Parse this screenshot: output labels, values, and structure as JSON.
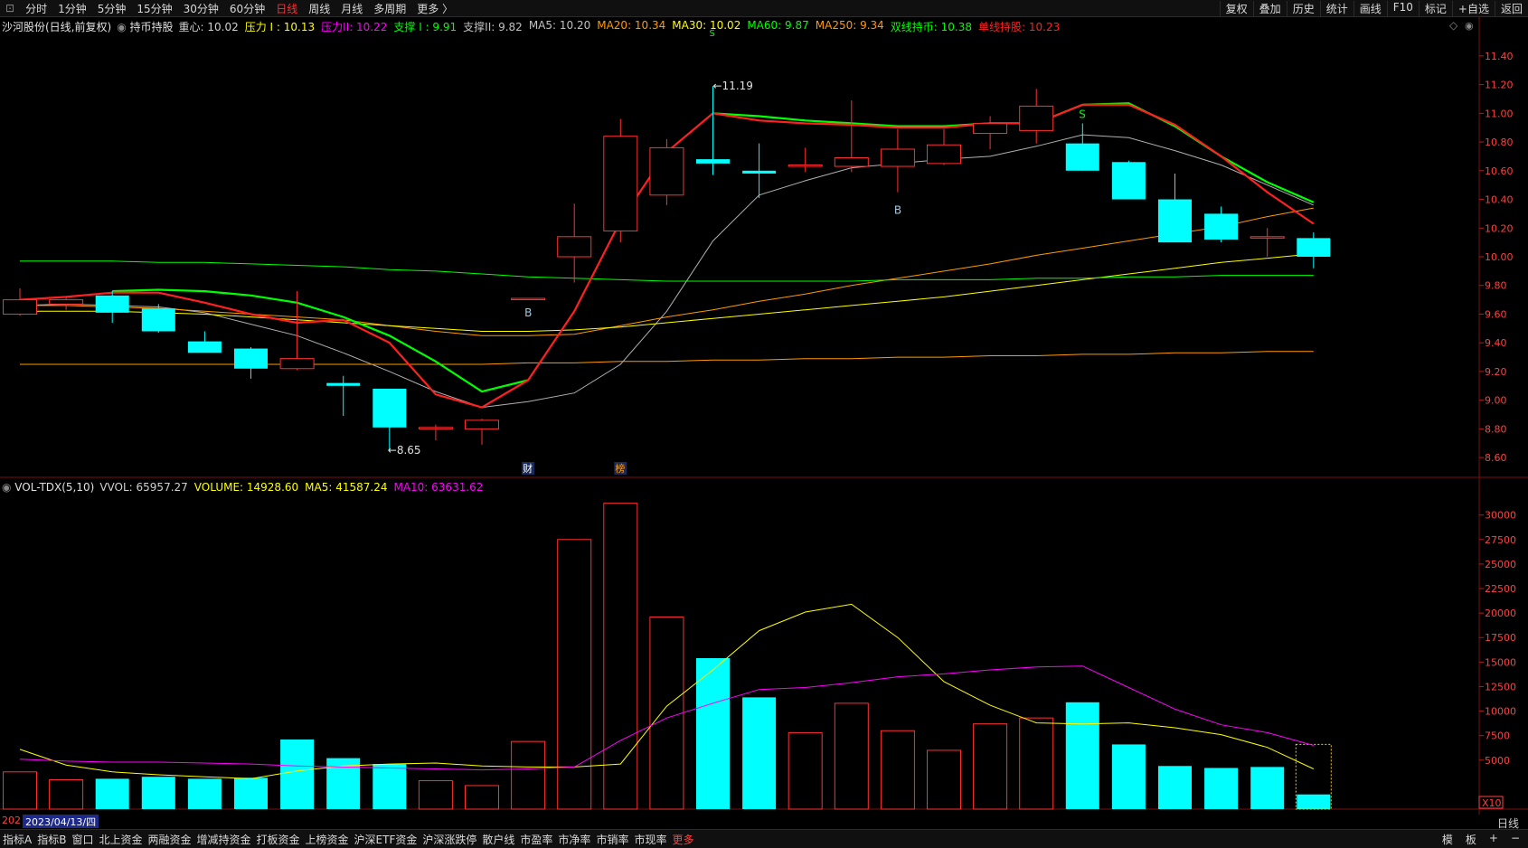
{
  "topbar": {
    "tabs": [
      "分时",
      "1分钟",
      "5分钟",
      "15分钟",
      "30分钟",
      "60分钟",
      "日线",
      "周线",
      "月线",
      "多周期",
      "更多 〉"
    ],
    "active_tab": "日线",
    "right_tabs": [
      "复权",
      "叠加",
      "历史",
      "统计",
      "画线",
      "F10",
      "标记",
      "+自选",
      "返回"
    ]
  },
  "main_legend": {
    "stock": "沙河股份(日线,前复权)",
    "indicator": "持币持股",
    "items": [
      {
        "text": "重心: 10.02",
        "color": "#d0d0d0"
      },
      {
        "text": "压力 I : 10.13",
        "color": "#ffff00"
      },
      {
        "text": "压力II: 10.22",
        "color": "#ff00ff"
      },
      {
        "text": "支撑 I : 9.91",
        "color": "#00ff00"
      },
      {
        "text": "支撑II: 9.82",
        "color": "#c0c0c0"
      },
      {
        "text": "MA5: 10.20",
        "color": "#c0c0c0"
      },
      {
        "text": "MA20: 10.34",
        "color": "#ff9900"
      },
      {
        "text": "MA30: 10.02",
        "color": "#ffff00"
      },
      {
        "text": "MA60: 9.87",
        "color": "#00ff00"
      },
      {
        "text": "MA250: 9.34",
        "color": "#ff9900"
      },
      {
        "text": "双线持币: 10.38",
        "color": "#00ff00"
      },
      {
        "text": "单线持股: 10.23",
        "color": "#ff2020"
      }
    ]
  },
  "vol_legend": {
    "name": "VOL-TDX(5,10)",
    "items": [
      {
        "text": "VVOL: 65957.27",
        "color": "#d0d0d0"
      },
      {
        "text": "VOLUME: 14928.60",
        "color": "#ffff00"
      },
      {
        "text": "MA5: 41587.24",
        "color": "#ffff00"
      },
      {
        "text": "MA10: 63631.62",
        "color": "#ff00ff"
      }
    ]
  },
  "markers": {
    "high_label": "11.19",
    "low_label": "8.65",
    "b1": "B",
    "b2": "B",
    "s1": "S",
    "s_top": "S",
    "cai": "财",
    "bang": "榜",
    "vol_scale": "X10",
    "vol_mark": "5"
  },
  "date_bar": {
    "year_prefix": "202",
    "date": "2023/04/13/四"
  },
  "period_label": "日线",
  "bottombar": {
    "tabs": [
      "指标A",
      "指标B",
      "窗口",
      "北上资金",
      "两融资金",
      "增减持资金",
      "打板资金",
      "上榜资金",
      "沪深ETF资金",
      "沪深涨跌停",
      "散户线",
      "市盈率",
      "市净率",
      "市销率",
      "市现率",
      "更多"
    ],
    "highlight": "更多",
    "right_tabs": [
      "模",
      "板",
      "+",
      "−"
    ]
  },
  "chart_data": [
    {
      "type": "candlestick",
      "ylim": [
        8.5,
        11.5
      ],
      "yticks": [
        8.6,
        8.8,
        9.0,
        9.2,
        9.4,
        9.6,
        9.8,
        10.0,
        10.2,
        10.4,
        10.6,
        10.8,
        11.0,
        11.2,
        11.4
      ],
      "candles": [
        {
          "o": 9.6,
          "h": 9.78,
          "l": 9.59,
          "c": 9.7
        },
        {
          "o": 9.67,
          "h": 9.72,
          "l": 9.63,
          "c": 9.7
        },
        {
          "o": 9.73,
          "h": 9.76,
          "l": 9.54,
          "c": 9.61
        },
        {
          "o": 9.64,
          "h": 9.67,
          "l": 9.47,
          "c": 9.48
        },
        {
          "o": 9.41,
          "h": 9.48,
          "l": 9.34,
          "c": 9.33
        },
        {
          "o": 9.36,
          "h": 9.37,
          "l": 9.15,
          "c": 9.22
        },
        {
          "o": 9.22,
          "h": 9.76,
          "l": 9.21,
          "c": 9.29
        },
        {
          "o": 9.12,
          "h": 9.17,
          "l": 8.89,
          "c": 9.1
        },
        {
          "o": 9.08,
          "h": 9.08,
          "l": 8.65,
          "c": 8.81
        },
        {
          "o": 8.8,
          "h": 8.83,
          "l": 8.72,
          "c": 8.81
        },
        {
          "o": 8.8,
          "h": 8.87,
          "l": 8.69,
          "c": 8.86
        },
        {
          "o": 9.71,
          "h": 9.71,
          "l": 9.71,
          "c": 9.71
        },
        {
          "o": 10.0,
          "h": 10.37,
          "l": 9.82,
          "c": 10.14
        },
        {
          "o": 10.18,
          "h": 10.96,
          "l": 10.1,
          "c": 10.84
        },
        {
          "o": 10.43,
          "h": 10.82,
          "l": 10.36,
          "c": 10.76
        },
        {
          "o": 10.68,
          "h": 11.19,
          "l": 10.57,
          "c": 10.65
        },
        {
          "o": 10.6,
          "h": 10.79,
          "l": 10.41,
          "c": 10.58
        },
        {
          "o": 10.63,
          "h": 10.76,
          "l": 10.59,
          "c": 10.64
        },
        {
          "o": 10.63,
          "h": 11.09,
          "l": 10.59,
          "c": 10.69
        },
        {
          "o": 10.63,
          "h": 10.89,
          "l": 10.45,
          "c": 10.75
        },
        {
          "o": 10.65,
          "h": 10.89,
          "l": 10.64,
          "c": 10.78
        },
        {
          "o": 10.86,
          "h": 10.98,
          "l": 10.75,
          "c": 10.93
        },
        {
          "o": 10.88,
          "h": 11.17,
          "l": 10.79,
          "c": 11.05
        },
        {
          "o": 10.79,
          "h": 10.93,
          "l": 10.6,
          "c": 10.6
        },
        {
          "o": 10.66,
          "h": 10.67,
          "l": 10.41,
          "c": 10.4
        },
        {
          "o": 10.4,
          "h": 10.58,
          "l": 10.29,
          "c": 10.1
        },
        {
          "o": 10.3,
          "h": 10.35,
          "l": 10.1,
          "c": 10.12
        },
        {
          "o": 10.13,
          "h": 10.2,
          "l": 10.0,
          "c": 10.14
        },
        {
          "o": 10.13,
          "h": 10.17,
          "l": 9.92,
          "c": 10.0
        }
      ],
      "series": [
        {
          "name": "MA5",
          "color": "#b0b0b0",
          "values": [
            9.66,
            9.67,
            9.66,
            9.65,
            9.61,
            9.53,
            9.45,
            9.33,
            9.2,
            9.06,
            8.95,
            8.99,
            9.05,
            9.25,
            9.62,
            10.11,
            10.43,
            10.53,
            10.62,
            10.65,
            10.68,
            10.7,
            10.77,
            10.85,
            10.83,
            10.74,
            10.64,
            10.5,
            10.36
          ]
        },
        {
          "name": "MA20",
          "color": "#ff9900",
          "values": [
            9.66,
            9.66,
            9.65,
            9.64,
            9.62,
            9.6,
            9.58,
            9.56,
            9.52,
            9.48,
            9.45,
            9.45,
            9.46,
            9.52,
            9.58,
            9.63,
            9.69,
            9.74,
            9.8,
            9.85,
            9.9,
            9.95,
            10.01,
            10.06,
            10.11,
            10.16,
            10.21,
            10.28,
            10.34
          ]
        },
        {
          "name": "MA30",
          "color": "#ffff00",
          "values": [
            9.62,
            9.62,
            9.62,
            9.61,
            9.6,
            9.58,
            9.56,
            9.54,
            9.52,
            9.5,
            9.48,
            9.48,
            9.49,
            9.51,
            9.54,
            9.57,
            9.6,
            9.63,
            9.66,
            9.69,
            9.72,
            9.76,
            9.8,
            9.84,
            9.88,
            9.92,
            9.96,
            9.99,
            10.02
          ]
        },
        {
          "name": "MA60",
          "color": "#00ff00",
          "values": [
            9.97,
            9.97,
            9.97,
            9.96,
            9.96,
            9.95,
            9.94,
            9.93,
            9.91,
            9.9,
            9.88,
            9.86,
            9.85,
            9.84,
            9.83,
            9.83,
            9.83,
            9.83,
            9.83,
            9.84,
            9.84,
            9.84,
            9.85,
            9.85,
            9.86,
            9.86,
            9.87,
            9.87,
            9.87
          ]
        },
        {
          "name": "MA250",
          "color": "#ff9900",
          "values": [
            9.25,
            9.25,
            9.25,
            9.25,
            9.25,
            9.25,
            9.25,
            9.25,
            9.25,
            9.25,
            9.25,
            9.26,
            9.26,
            9.27,
            9.27,
            9.28,
            9.28,
            9.29,
            9.29,
            9.3,
            9.3,
            9.31,
            9.31,
            9.32,
            9.32,
            9.33,
            9.33,
            9.34,
            9.34
          ]
        },
        {
          "name": "双线持币",
          "color": "#00ff00",
          "values": [
            null,
            null,
            9.76,
            9.77,
            9.76,
            9.73,
            9.68,
            9.58,
            9.45,
            9.27,
            9.06,
            9.14,
            null,
            null,
            null,
            11.0,
            10.98,
            10.95,
            10.93,
            10.91,
            10.91,
            10.93,
            10.93,
            11.06,
            11.07,
            10.91,
            10.7,
            10.52,
            10.38
          ]
        },
        {
          "name": "单线持股",
          "color": "#ff2020",
          "values": [
            9.7,
            9.72,
            9.75,
            9.75,
            9.68,
            9.6,
            9.54,
            9.56,
            9.4,
            9.04,
            8.95,
            9.14,
            9.62,
            10.25,
            10.73,
            11.0,
            10.95,
            10.93,
            10.92,
            10.9,
            10.9,
            10.93,
            10.93,
            11.06,
            11.06,
            10.92,
            10.7,
            10.45,
            10.23
          ]
        }
      ]
    },
    {
      "type": "bar",
      "title": "VOL-TDX(5,10)",
      "ylim": [
        0,
        32000
      ],
      "yticks": [
        5000,
        7500,
        10000,
        12500,
        15000,
        17500,
        20000,
        22500,
        25000,
        27500,
        30000
      ],
      "values": [
        3800,
        3000,
        3100,
        3300,
        3100,
        3200,
        7100,
        5200,
        4600,
        2900,
        2400,
        6900,
        27500,
        31200,
        19600,
        15400,
        11400,
        7800,
        10800,
        8000,
        6000,
        8700,
        9300,
        10900,
        6600,
        4400,
        4200,
        4300,
        1500
      ],
      "up": [
        true,
        true,
        false,
        false,
        false,
        false,
        false,
        false,
        false,
        true,
        true,
        true,
        true,
        true,
        true,
        false,
        false,
        true,
        true,
        true,
        true,
        true,
        true,
        false,
        false,
        false,
        false,
        false,
        false
      ],
      "series": [
        {
          "name": "MA5",
          "color": "#ffff00",
          "values": [
            6100,
            4500,
            3800,
            3500,
            3300,
            3100,
            3900,
            4400,
            4600,
            4700,
            4400,
            4300,
            4300,
            4600,
            10500,
            14200,
            18200,
            20100,
            20900,
            17500,
            13000,
            10600,
            8800,
            8700,
            8800,
            8300,
            7600,
            6300,
            4100
          ]
        },
        {
          "name": "MA10",
          "color": "#ff00ff",
          "values": [
            5100,
            4900,
            4800,
            4800,
            4700,
            4600,
            4400,
            4300,
            4200,
            4100,
            4000,
            4100,
            4300,
            7000,
            9300,
            10800,
            12200,
            12400,
            12900,
            13500,
            13800,
            14200,
            14500,
            14600,
            12400,
            10200,
            8600,
            7800,
            6500
          ]
        }
      ]
    }
  ]
}
